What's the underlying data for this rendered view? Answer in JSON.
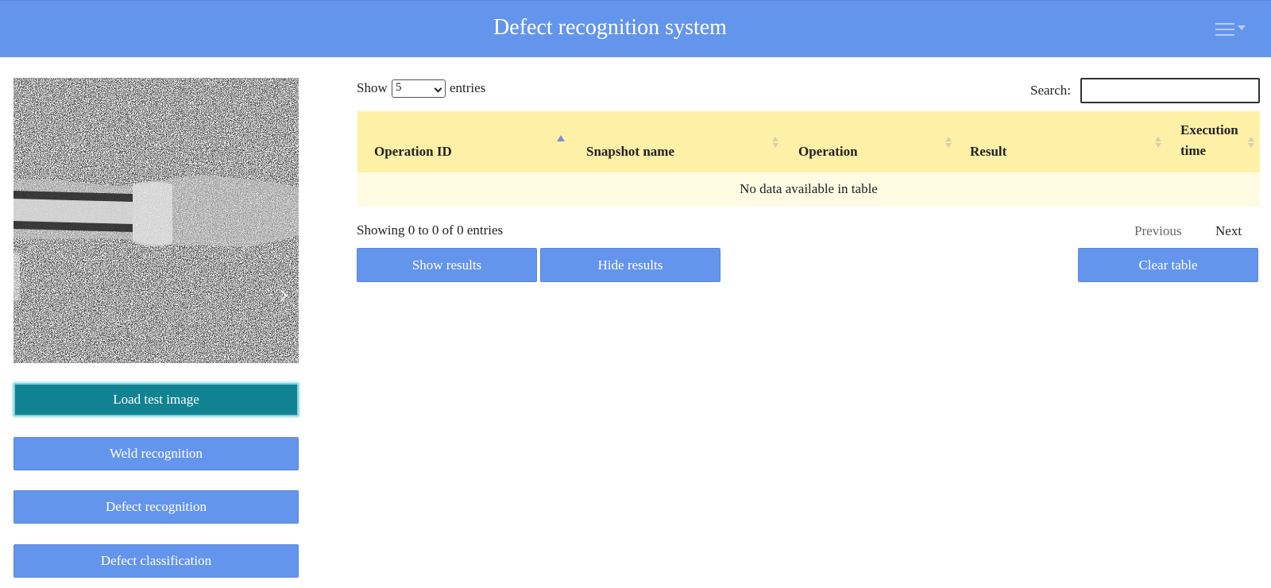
{
  "header": {
    "title": "Defect recognition system",
    "menu_icon": "hamburger-icon"
  },
  "preview": {
    "next_glyph": "›"
  },
  "sidebar": {
    "buttons": [
      {
        "label": "Load test image",
        "active": true
      },
      {
        "label": "Weld recognition"
      },
      {
        "label": "Defect recognition"
      },
      {
        "label": "Defect classification"
      }
    ]
  },
  "table_controls": {
    "show_label": "Show",
    "entries_label": "entries",
    "length_value": "5",
    "search_label": "Search:",
    "search_value": ""
  },
  "table": {
    "columns": [
      "Operation ID",
      "Snapshot name",
      "Operation",
      "Result",
      "Execution",
      "time"
    ],
    "sorted_column": "Operation ID",
    "sort_direction": "ascending",
    "empty_message": "No data available in table"
  },
  "footer": {
    "info": "Showing 0 to 0 of 0 entries",
    "previous": "Previous",
    "next": "Next"
  },
  "actions": {
    "show_results": "Show results",
    "hide_results": "Hide results",
    "clear_table": "Clear table"
  },
  "colors": {
    "navbar": "#6495ed",
    "button": "#6495ed",
    "active_button": "#118291",
    "table_header": "#fff0a8",
    "table_row": "#fffbe3"
  }
}
